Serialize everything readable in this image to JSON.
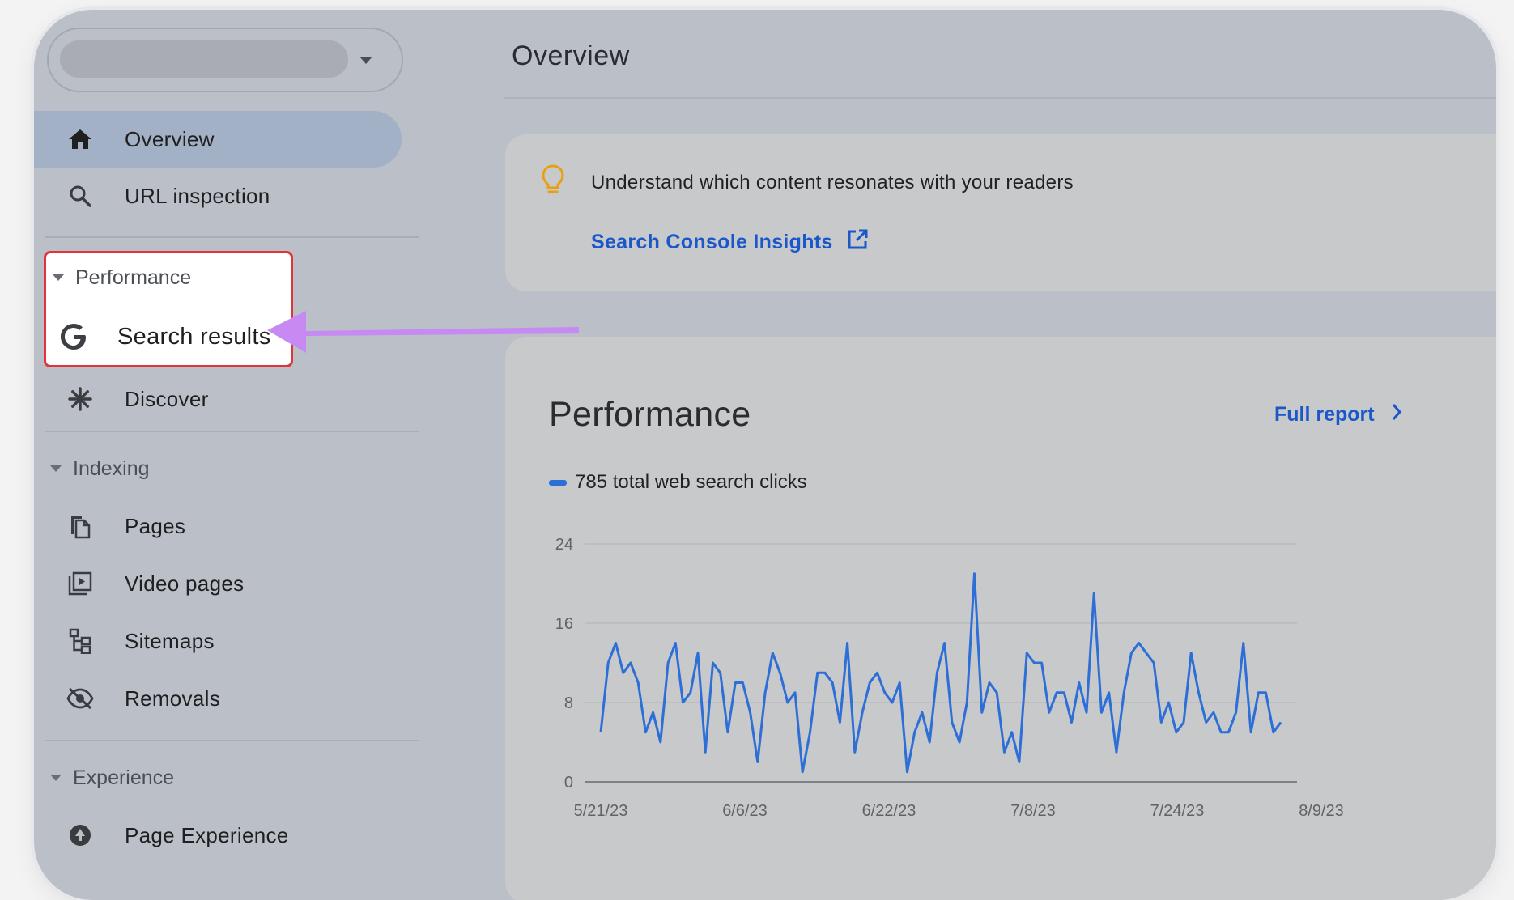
{
  "sidebar": {
    "property_selector": {
      "value": ""
    },
    "top_items": [
      {
        "label": "Overview",
        "icon": "home-icon",
        "active": true
      },
      {
        "label": "URL inspection",
        "icon": "search-icon",
        "active": false
      }
    ],
    "performance": {
      "label": "Performance",
      "items": [
        {
          "label": "Search results",
          "icon": "google-g-icon"
        },
        {
          "label": "Discover",
          "icon": "asterisk-icon"
        }
      ]
    },
    "indexing": {
      "label": "Indexing",
      "items": [
        {
          "label": "Pages",
          "icon": "pages-icon"
        },
        {
          "label": "Video pages",
          "icon": "video-pages-icon"
        },
        {
          "label": "Sitemaps",
          "icon": "sitemaps-icon"
        },
        {
          "label": "Removals",
          "icon": "removals-icon"
        }
      ]
    },
    "experience": {
      "label": "Experience",
      "items": [
        {
          "label": "Page Experience",
          "icon": "page-experience-icon"
        }
      ]
    }
  },
  "main": {
    "title": "Overview",
    "insight": {
      "text": "Understand which content resonates with your readers",
      "link_label": "Search Console Insights"
    },
    "performance": {
      "title": "Performance",
      "full_report_label": "Full report",
      "legend": "785 total web search clicks"
    }
  },
  "colors": {
    "accent_blue": "#1a57c9",
    "line_blue": "#2d6fd6",
    "highlight_border": "#e0343a",
    "arrow_purple": "#c78af2",
    "bulb_amber": "#e8a013"
  },
  "chart_data": {
    "type": "line",
    "title": "",
    "xlabel": "",
    "ylabel": "",
    "ylim": [
      0,
      24
    ],
    "y_ticks": [
      "0",
      "8",
      "16",
      "24"
    ],
    "x_tick_labels": [
      "5/21/23",
      "6/6/23",
      "6/22/23",
      "7/8/23",
      "7/24/23",
      "8/9/23"
    ],
    "series": [
      {
        "name": "785 total web search clicks",
        "values": [
          5,
          12,
          14,
          11,
          12,
          10,
          5,
          7,
          4,
          12,
          14,
          8,
          9,
          13,
          3,
          12,
          11,
          5,
          10,
          10,
          7,
          2,
          9,
          13,
          11,
          8,
          9,
          1,
          5,
          11,
          11,
          10,
          6,
          14,
          3,
          7,
          10,
          11,
          9,
          8,
          10,
          1,
          5,
          7,
          4,
          11,
          14,
          6,
          4,
          8,
          21,
          7,
          10,
          9,
          3,
          5,
          2,
          13,
          12,
          12,
          7,
          9,
          9,
          6,
          10,
          7,
          19,
          7,
          9,
          3,
          9,
          13,
          14,
          13,
          12,
          6,
          8,
          5,
          6,
          13,
          9,
          6,
          7,
          5,
          5,
          7,
          14,
          5,
          9,
          9,
          5,
          6
        ]
      }
    ]
  }
}
